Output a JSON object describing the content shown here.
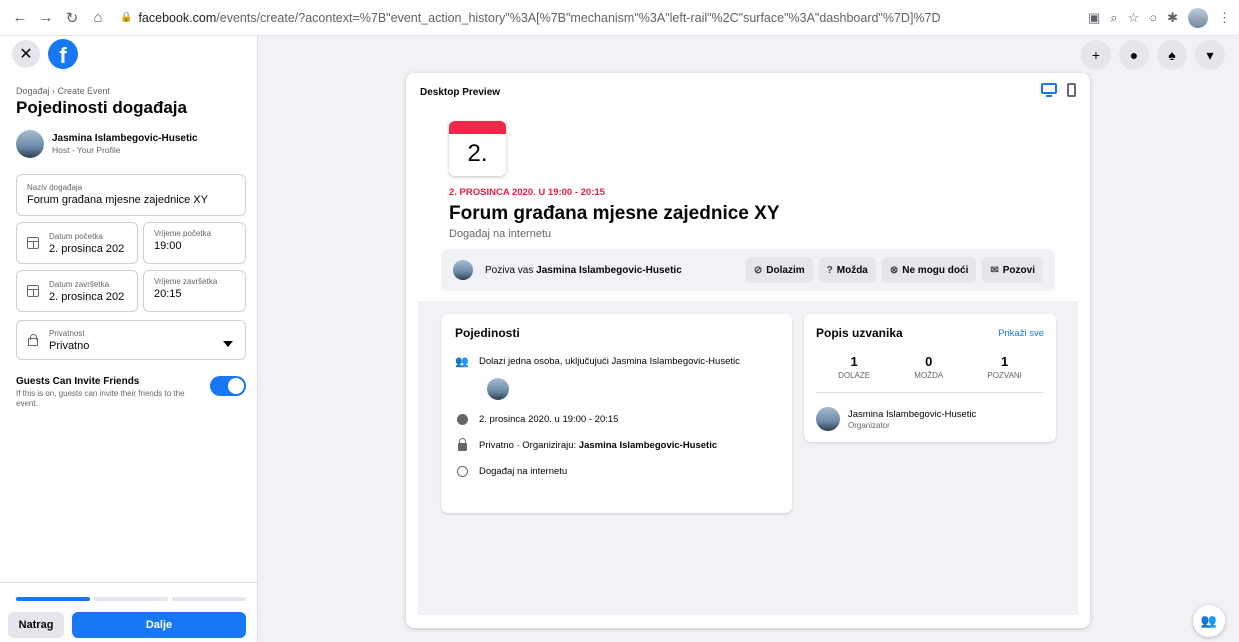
{
  "browser": {
    "domain": "facebook.com",
    "path": "/events/create/?acontext=%7B\"event_action_history\"%3A[%7B\"mechanism\"%3A\"left-rail\"%2C\"surface\"%3A\"dashboard\"%7D]%7D"
  },
  "sidebar": {
    "breadcrumb": "Događaj › Create Event",
    "title": "Pojedinosti događaja",
    "host_name": "Jasmina Islambegovic-Husetic",
    "host_sub": "Host - Your Profile",
    "event_name_label": "Naziv događaja",
    "event_name_value": "Forum građana mjesne zajednice XY",
    "start_date_label": "Datum početka",
    "start_date_value": "2. prosinca 202",
    "start_time_label": "Vrijeme početka",
    "start_time_value": "19:00",
    "end_date_label": "Datum završetka",
    "end_date_value": "2. prosinca 202",
    "end_time_label": "Vrijeme završetka",
    "end_time_value": "20:15",
    "privacy_label": "Privatnost",
    "privacy_value": "Privatno",
    "guests_title": "Guests Can Invite Friends",
    "guests_desc": "If this is on, guests can invite their friends to the event.",
    "back_label": "Natrag",
    "next_label": "Dalje",
    "progress": 0.33
  },
  "preview": {
    "label": "Desktop Preview",
    "day": "2.",
    "date_line": "2. PROSINCA 2020. U 19:00 - 20:15",
    "title": "Forum građana mjesne zajednice XY",
    "subtitle": "Događaj na internetu",
    "invite_prefix": "Poziva vas",
    "invite_name": "Jasmina Islambegovic-Husetic",
    "btn_going": "Dolazim",
    "btn_maybe": "Možda",
    "btn_cant": "Ne mogu doći",
    "btn_invite": "Pozovi"
  },
  "details": {
    "title": "Pojedinosti",
    "attending": "Dolazi jedna osoba, uključujući Jasmina Islambegovic-Husetic",
    "datetime": "2. prosinca 2020. u 19:00 - 20:15",
    "privacy_prefix": "Privatno · Organiziraju:",
    "privacy_name": "Jasmina Islambegovic-Husetic",
    "location": "Događaj na internetu"
  },
  "guestlist": {
    "title": "Popis uzvanika",
    "show_all": "Prikaži sve",
    "going_n": "1",
    "going_l": "DOLAZE",
    "maybe_n": "0",
    "maybe_l": "MOŽDA",
    "invited_n": "1",
    "invited_l": "POZVANI",
    "guest_name": "Jasmina Islambegovic-Husetic",
    "guest_role": "Organizator"
  },
  "colors": {
    "accent": "#1877f2",
    "date_red": "#e41e3f",
    "calendar_top": "#f02849"
  },
  "icons": [
    "back-icon",
    "forward-icon",
    "reload-icon",
    "home-icon",
    "lock-icon",
    "plus-icon",
    "messenger-icon",
    "bell-icon",
    "caret-icon"
  ]
}
